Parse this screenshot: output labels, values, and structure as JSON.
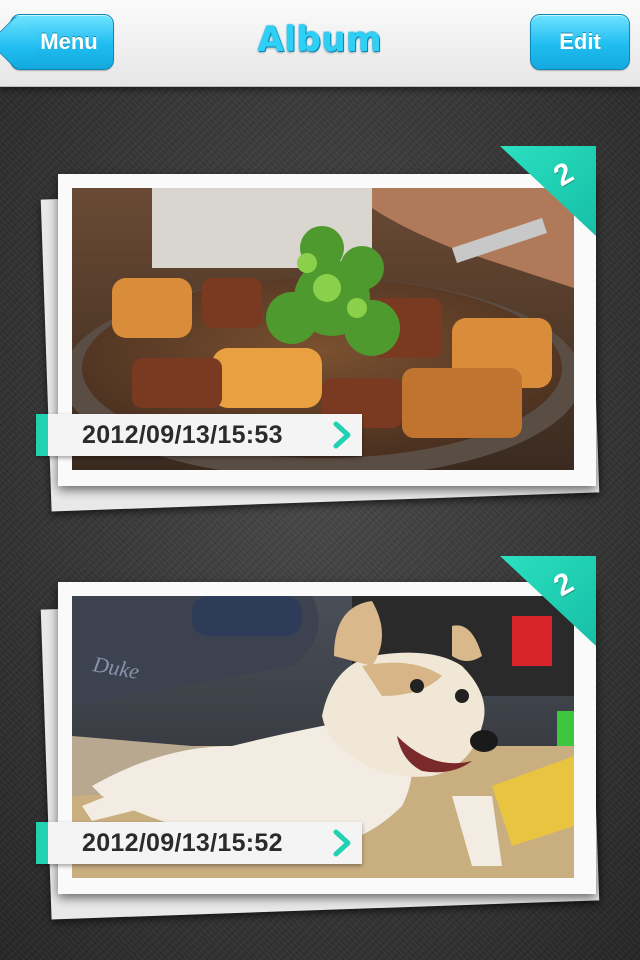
{
  "header": {
    "title": "Album",
    "menu_label": "Menu",
    "edit_label": "Edit"
  },
  "albums": [
    {
      "date": "2012/09/13/15:53",
      "count": "2",
      "photo_desc": "braised pork with vegetables"
    },
    {
      "date": "2012/09/13/15:52",
      "count": "2",
      "photo_desc": "dog lying on cardboard"
    }
  ],
  "colors": {
    "accent_blue": "#2fd0f5",
    "accent_teal": "#22d1b2",
    "background": "#363636"
  },
  "icons": {
    "chevron": "chevron-right-icon",
    "back": "back-arrow-button"
  }
}
